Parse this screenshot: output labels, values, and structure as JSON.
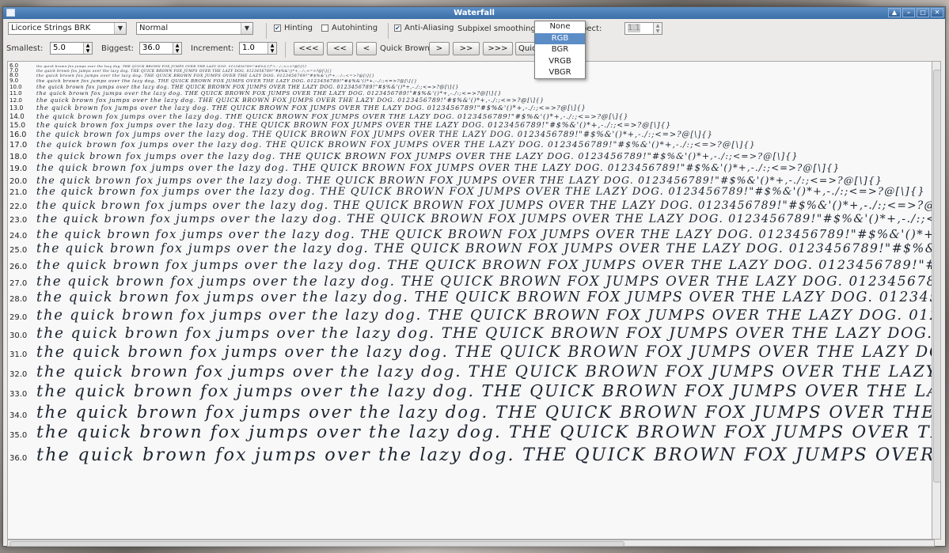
{
  "window": {
    "title": "Waterfall"
  },
  "toolbar": {
    "font_name": "Licorice Strings BRK",
    "font_style": "Normal",
    "hinting_label": "Hinting",
    "hinting_checked": true,
    "autohinting_label": "Autohinting",
    "autohinting_checked": false,
    "antialiasing_label": "Anti-Aliasing",
    "antialiasing_checked": true,
    "subpixel_label": "Subpixel smoothing:",
    "subpixel_value": "None",
    "aspect_label": "Aspect:",
    "aspect_value": "1.1",
    "smallest_label": "Smallest:",
    "smallest_value": "5.0",
    "biggest_label": "Biggest:",
    "biggest_value": "36.0",
    "increment_label": "Increment:",
    "increment_value": "1.0",
    "nav_first": "<<<",
    "nav_prev_page": "<<",
    "nav_prev": "<",
    "text_preset": "Quick Brown",
    "nav_next": ">",
    "nav_next_page": ">>",
    "nav_last": ">>>",
    "text_preset_button": "Quick"
  },
  "subpixel_options": [
    "None",
    "RGB",
    "BGR",
    "VRGB",
    "VBGR"
  ],
  "subpixel_selected": "RGB",
  "sample_text": "the quick brown fox jumps over the lazy dog. THE QUICK BROWN FOX JUMPS OVER THE LAZY DOG. 0123456789!\"#$%&'()*+,-./:;<=>?@[\\]{}",
  "sizes": [
    "6.0",
    "7.0",
    "8.0",
    "9.0",
    "10.0",
    "11.0",
    "12.0",
    "13.0",
    "14.0",
    "15.0",
    "16.0",
    "17.0",
    "18.0",
    "19.0",
    "20.0",
    "21.0",
    "22.0",
    "23.0",
    "24.0",
    "25.0",
    "26.0",
    "27.0",
    "28.0",
    "29.0",
    "30.0",
    "31.0",
    "32.0",
    "33.0",
    "34.0",
    "35.0",
    "36.0"
  ],
  "colors": {
    "title_bar": "#3b6ea8",
    "selection": "#5c8dc7",
    "text": "#1c2430"
  }
}
